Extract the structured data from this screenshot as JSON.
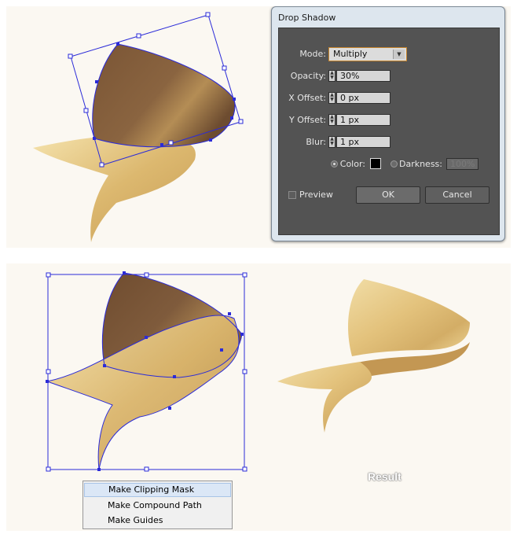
{
  "dialog": {
    "title": "Drop Shadow",
    "mode_label": "Mode:",
    "mode_value": "Multiply",
    "opacity_label": "Opacity:",
    "opacity_value": "30%",
    "x_offset_label": "X Offset:",
    "x_offset_value": "0 px",
    "y_offset_label": "Y Offset:",
    "y_offset_value": "1 px",
    "blur_label": "Blur:",
    "blur_value": "1 px",
    "color_label": "Color:",
    "darkness_label": "Darkness:",
    "darkness_value": "100%",
    "preview_label": "Preview",
    "ok_label": "OK",
    "cancel_label": "Cancel",
    "shadow_color": "#000000"
  },
  "context_menu": {
    "items": [
      "Make Clipping Mask",
      "Make Compound Path",
      "Make Guides"
    ]
  },
  "result_label": "Result",
  "colors": {
    "canvas_bg": "#fbf8f2",
    "selection_blue": "#2b2bd8",
    "brown": "#7d5a3c",
    "gold_light": "#f0dba3",
    "gold_dark": "#c9a25e"
  }
}
